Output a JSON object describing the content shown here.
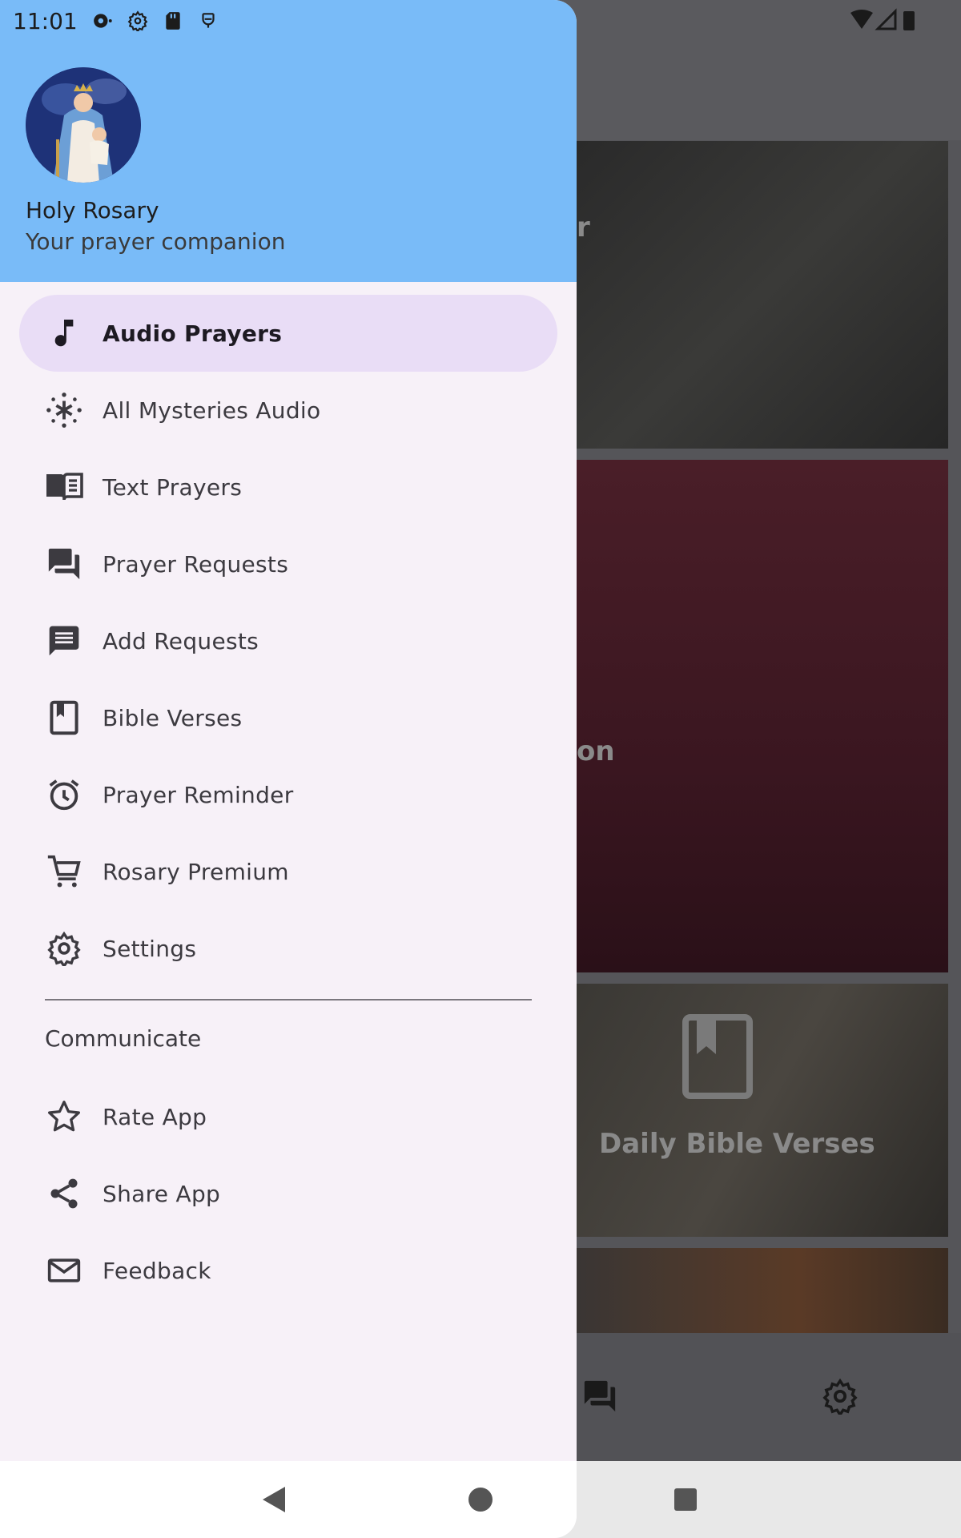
{
  "status_bar": {
    "time": "11:01"
  },
  "drawer": {
    "app_name": "Holy Rosary",
    "subtitle": "Your prayer companion",
    "items": [
      {
        "label": "Audio Prayers",
        "icon": "music-note-icon",
        "active": true
      },
      {
        "label": "All Mysteries Audio",
        "icon": "sparkle-icon"
      },
      {
        "label": "Text Prayers",
        "icon": "book-open-icon"
      },
      {
        "label": "Prayer Requests",
        "icon": "forum-icon"
      },
      {
        "label": "Add Requests",
        "icon": "message-icon"
      },
      {
        "label": "Bible Verses",
        "icon": "bookmark-book-icon"
      },
      {
        "label": "Prayer Reminder",
        "icon": "alarm-icon"
      },
      {
        "label": "Rosary Premium",
        "icon": "cart-icon"
      },
      {
        "label": "Settings",
        "icon": "gear-icon"
      }
    ],
    "section_title": "Communicate",
    "communicate_items": [
      {
        "label": "Rate App",
        "icon": "star-icon"
      },
      {
        "label": "Share App",
        "icon": "share-icon"
      },
      {
        "label": "Feedback",
        "icon": "mail-icon"
      }
    ]
  },
  "background": {
    "card1_fragment": "r",
    "card2_fragment": "on",
    "card3_title": "Daily Bible Verses"
  },
  "colors": {
    "header": "#79bbf8",
    "drawer_bg": "#f7f1f8",
    "active_item": "#e9ddf6"
  }
}
